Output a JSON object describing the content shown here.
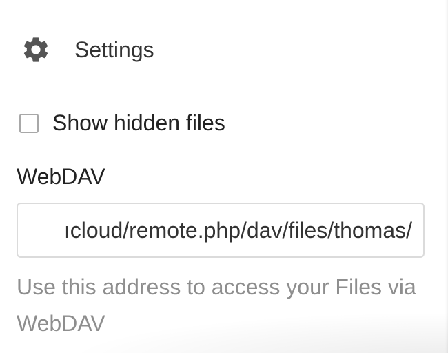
{
  "settings": {
    "icon": "gear-icon",
    "title": "Settings"
  },
  "show_hidden": {
    "label": "Show hidden files",
    "checked": false
  },
  "webdav": {
    "label": "WebDAV",
    "url_visible": "ıcloud/remote.php/dav/files/thomas/",
    "hint": "Use this address to access your Files via WebDAV"
  },
  "colors": {
    "text": "#222222",
    "muted": "#8e8e8e",
    "border": "#dbdbdb",
    "icon": "#555555"
  }
}
